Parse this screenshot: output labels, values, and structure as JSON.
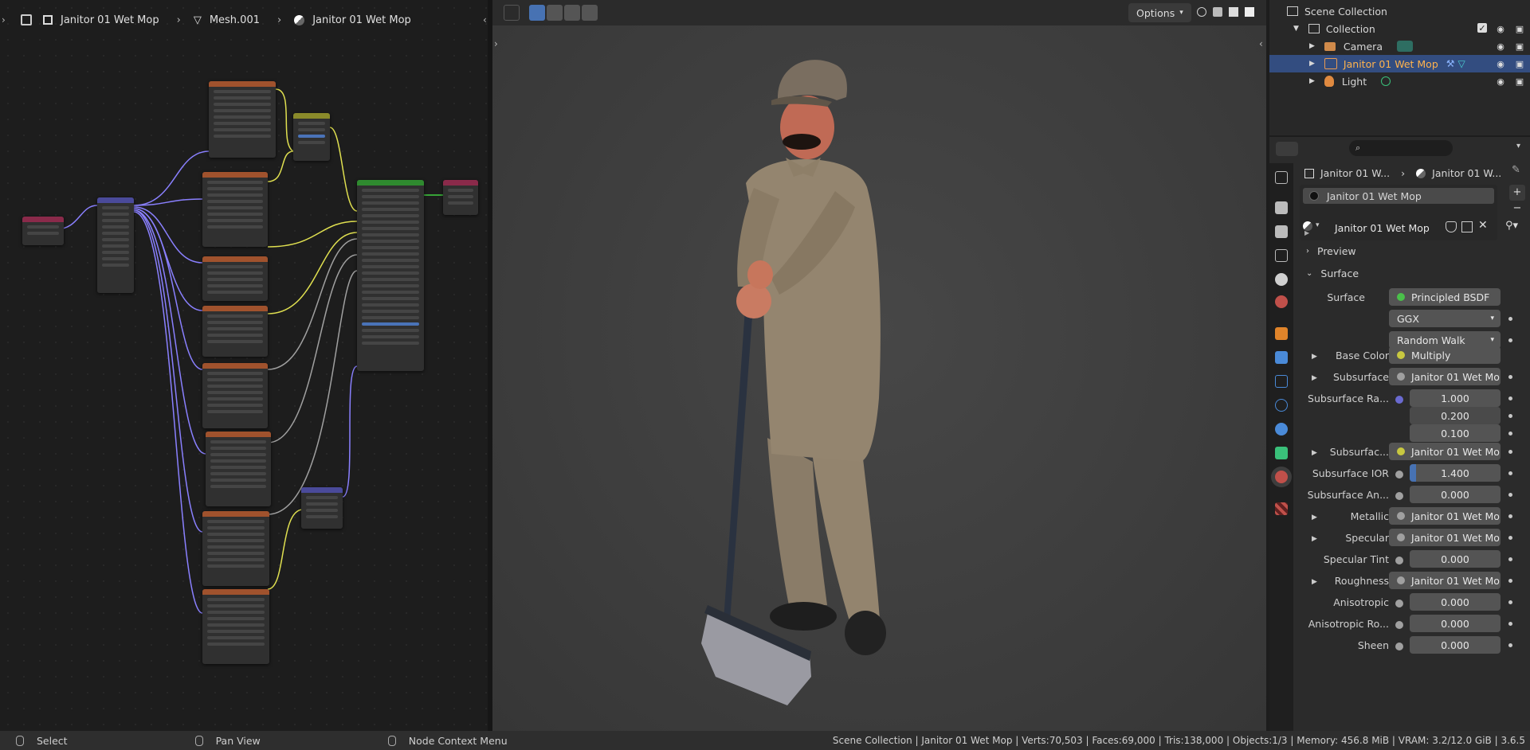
{
  "node_editor": {
    "breadcrumb": [
      {
        "label": "Janitor 01 Wet Mop",
        "icon": "object-icon"
      },
      {
        "label": "Mesh.001",
        "icon": "mesh-data-icon"
      },
      {
        "label": "Janitor 01 Wet Mop",
        "icon": "material-icon"
      }
    ],
    "header_colors": {
      "texture": "#a0522d",
      "mapping": "#4a4a9a",
      "texcoord": "#8a2a4a",
      "shader": "#2f8a2f",
      "output": "#8a2a4a",
      "mix": "#8a8a2a",
      "normal_map": "#4a4a9a"
    }
  },
  "viewport": {
    "options_label": "Options",
    "tools": [
      "select-tweak-icon",
      "select-box-icon",
      "select-extend-icon",
      "select-subtract-icon",
      "select-intersect-icon"
    ]
  },
  "outliner": {
    "root": "Scene Collection",
    "collection": "Collection",
    "items": [
      {
        "label": "Camera",
        "icon": "camera-icon",
        "selected": false
      },
      {
        "label": "Janitor 01 Wet Mop",
        "icon": "mesh-object-icon",
        "selected": true
      },
      {
        "label": "Light",
        "icon": "light-icon",
        "selected": false
      }
    ]
  },
  "properties": {
    "search_placeholder": "",
    "breadcrumb": [
      "Janitor 01 W...",
      "Janitor 01 W..."
    ],
    "slot_name": "Janitor 01 Wet Mop",
    "material_name": "Janitor 01 Wet Mop",
    "panels": {
      "preview": "Preview",
      "surface": "Surface"
    },
    "surface_label": "Surface",
    "surface_value": "Principled BSDF",
    "distribution": "GGX",
    "subsurface_method": "Random Walk",
    "rows": [
      {
        "label": "Base Color",
        "value": "Multiply",
        "expand": true,
        "dot": "#c8c840"
      },
      {
        "label": "Subsurface",
        "value": "Janitor 01 Wet Mop...",
        "expand": true,
        "dot": "#a0a0a0"
      },
      {
        "label": "Subsurface Ra...",
        "value": "",
        "expand": false,
        "dot": "#6a6ad0"
      },
      {
        "label": "Subsurfac...",
        "value": "Janitor 01 Wet Mop...",
        "expand": true,
        "dot": "#c8c840"
      },
      {
        "label": "Subsurface IOR",
        "value": "1.400",
        "expand": false,
        "dot": "#a0a0a0"
      },
      {
        "label": "Subsurface An...",
        "value": "0.000",
        "expand": false,
        "dot": "#a0a0a0"
      },
      {
        "label": "Metallic",
        "value": "Janitor 01 Wet Mop...",
        "expand": true,
        "dot": "#a0a0a0"
      },
      {
        "label": "Specular",
        "value": "Janitor 01 Wet Mop...",
        "expand": true,
        "dot": "#a0a0a0"
      },
      {
        "label": "Specular Tint",
        "value": "0.000",
        "expand": false,
        "dot": "#a0a0a0"
      },
      {
        "label": "Roughness",
        "value": "Janitor 01 Wet Mop...",
        "expand": true,
        "dot": "#a0a0a0"
      },
      {
        "label": "Anisotropic",
        "value": "0.000",
        "expand": false,
        "dot": "#a0a0a0"
      },
      {
        "label": "Anisotropic Ro...",
        "value": "0.000",
        "expand": false,
        "dot": "#a0a0a0"
      },
      {
        "label": "Sheen",
        "value": "0.000",
        "expand": false,
        "dot": "#a0a0a0"
      }
    ],
    "radius": [
      "1.000",
      "0.200",
      "0.100"
    ],
    "ior_fill": 0.07
  },
  "statusbar": {
    "select": "Select",
    "pan": "Pan View",
    "context": "Node Context Menu",
    "stats": "Scene Collection | Janitor 01 Wet Mop | Verts:70,503 | Faces:69,000 | Tris:138,000 | Objects:1/3 | Memory: 456.8 MiB | VRAM: 3.2/12.0 GiB | 3.6.5"
  }
}
